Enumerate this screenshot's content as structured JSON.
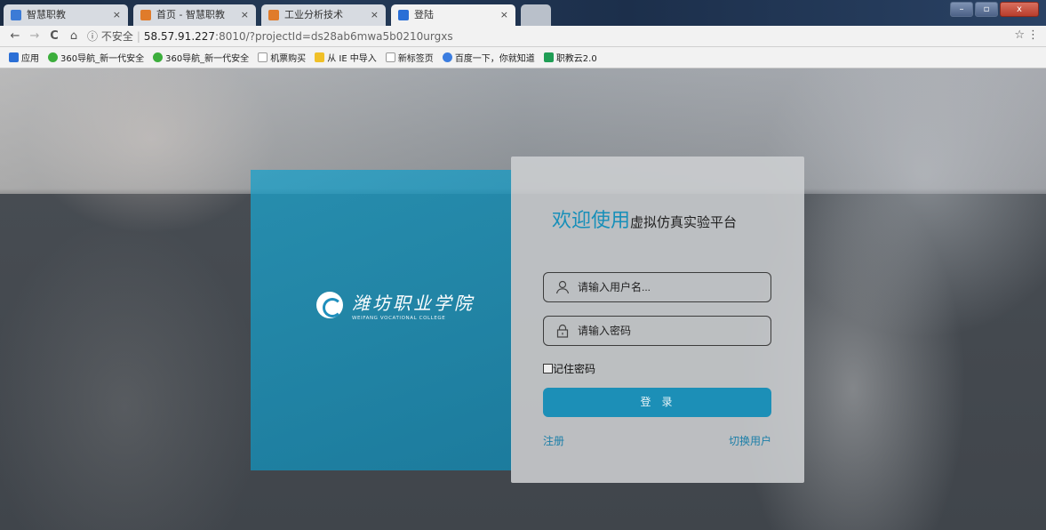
{
  "browser": {
    "tabs": [
      {
        "label": "智慧职教",
        "active": false,
        "icon_color": "#3c7bd6"
      },
      {
        "label": "首页 - 智慧职教",
        "active": false,
        "icon_color": "#e07b2a"
      },
      {
        "label": "工业分析技术",
        "active": false,
        "icon_color": "#e07b2a"
      },
      {
        "label": "登陆",
        "active": true,
        "icon_color": "#2a6fd6"
      }
    ],
    "tab_close": "×",
    "window_buttons": {
      "minimize": "–",
      "maximize": "▫",
      "close": "x"
    },
    "nav": {
      "back": "←",
      "forward": "→",
      "reload": "C",
      "home": "⌂"
    },
    "security_label": "ⓘ 不安全",
    "url_host": "58.57.91.227",
    "url_rest": ":8010/?projectId=ds28ab6mwa5b0210urgxs",
    "bookmark_star": "☆",
    "menu": "⋮",
    "bookmarks": [
      {
        "label": "应用",
        "icon_color": "#2b6fd6"
      },
      {
        "label": "360导航_新一代安全",
        "icon_color": "#3cae3c"
      },
      {
        "label": "360导航_新一代安全",
        "icon_color": "#3cae3c"
      },
      {
        "label": "机票购买",
        "icon_color": "#bbbbbb"
      },
      {
        "label": "从 IE 中导入",
        "icon_color": "#f0c028"
      },
      {
        "label": "新标签页",
        "icon_color": "#bbbbbb"
      },
      {
        "label": "百度一下，你就知道",
        "icon_color": "#3b7de0"
      },
      {
        "label": "职教云2.0",
        "icon_color": "#1f9d55"
      }
    ]
  },
  "brand": {
    "name_cn": "潍坊职业学院",
    "name_en": "WEIFANG VOCATIONAL COLLEGE"
  },
  "login": {
    "welcome_big": "欢迎使用",
    "welcome_small": "虚拟仿真实验平台",
    "username_placeholder": "请输入用户名...",
    "password_placeholder": "请输入密码",
    "remember_label": "记住密码",
    "submit_label": "登录",
    "register_link": "注册",
    "switch_user_link": "切换用户"
  },
  "colors": {
    "accent": "#178fb9",
    "button": "#1c8fb7",
    "brand_panel": "#1ea0c8"
  }
}
